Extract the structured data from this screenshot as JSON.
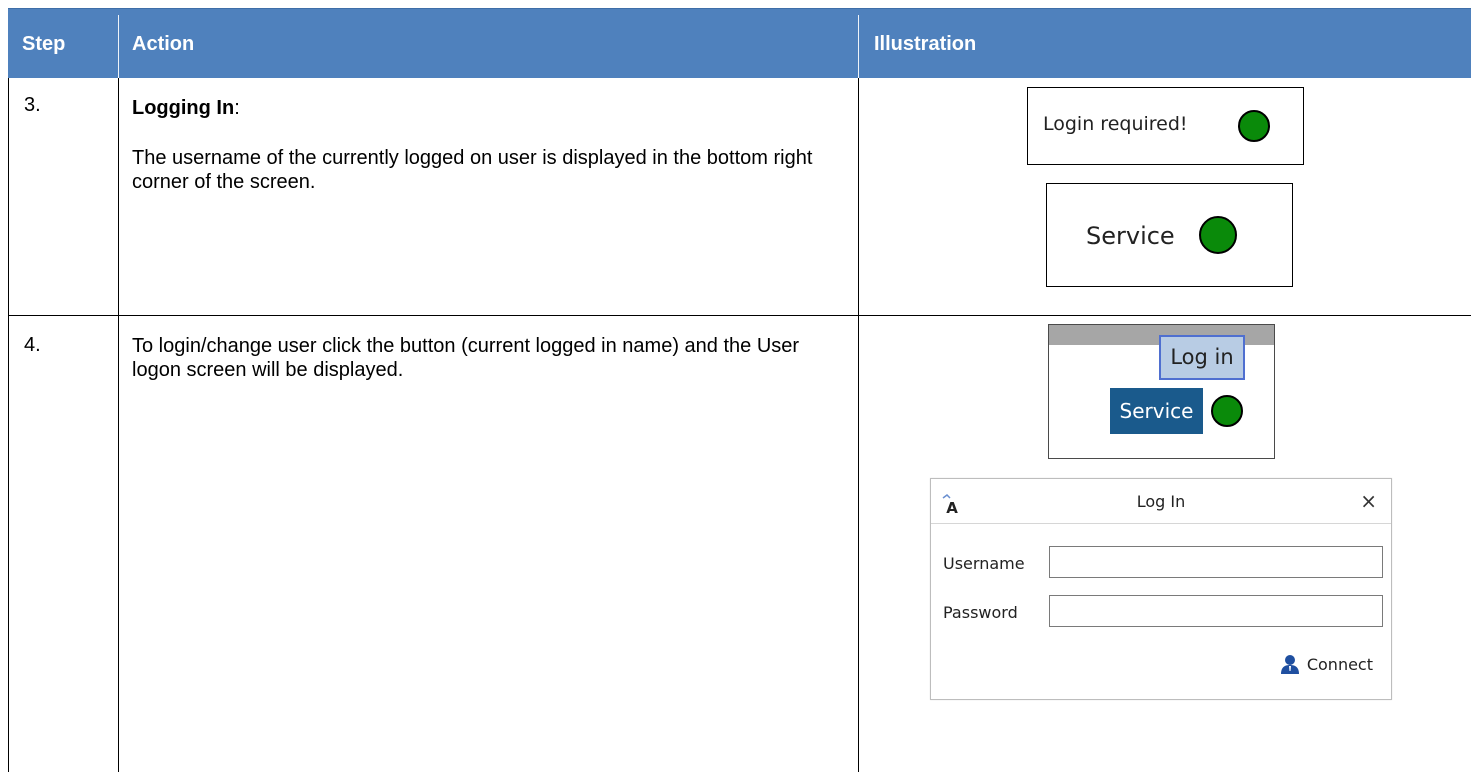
{
  "header": {
    "step": "Step",
    "action": "Action",
    "illustration": "Illustration"
  },
  "rows": [
    {
      "step": "3.",
      "title": "Logging In",
      "title_suffix": ":",
      "text": "The username of the currently logged on user is displayed in the bottom right corner of the screen.",
      "illustration": {
        "status_login_required": "Login required!",
        "status_service": "Service"
      }
    },
    {
      "step": "4.",
      "text": "To login/change user click the button (current logged in name) and the User logon screen will be displayed.",
      "illustration": {
        "login_button": "Log in",
        "service_button": "Service",
        "dialog": {
          "title": "Log In",
          "close": "×",
          "app_icon_letter": "A",
          "username_label": "Username",
          "username_value": "",
          "password_label": "Password",
          "password_value": "",
          "connect_label": "Connect"
        }
      }
    }
  ],
  "colors": {
    "header_bg": "#4f81bd",
    "status_green": "#0a8a0a",
    "service_bg": "#1a5a8c",
    "login_btn_bg": "#b8cce4"
  }
}
